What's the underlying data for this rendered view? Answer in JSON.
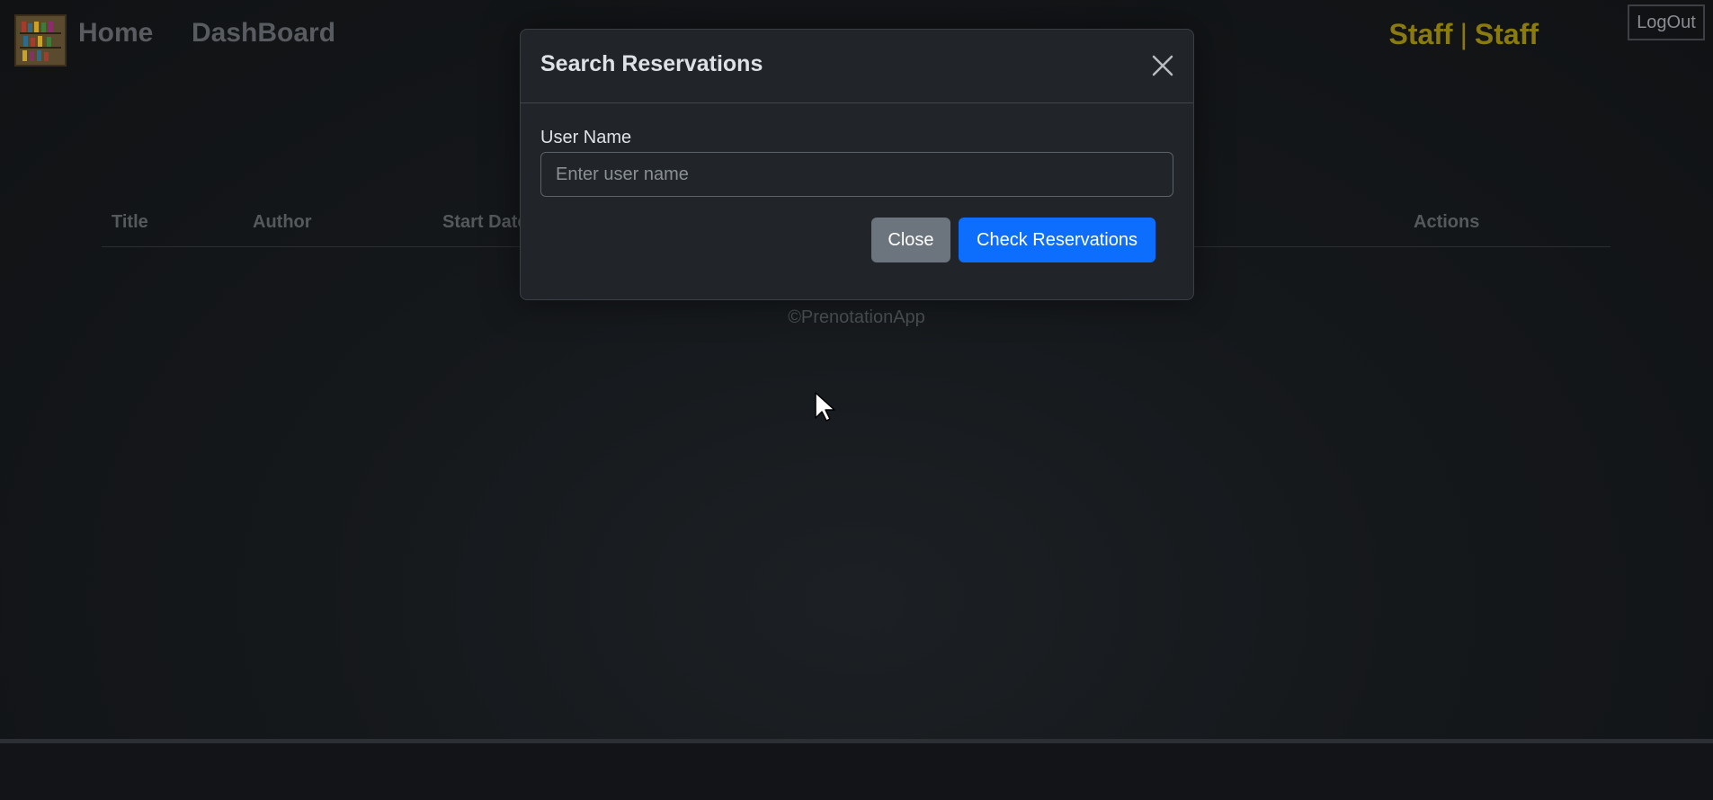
{
  "navbar": {
    "nav_links": [
      "Home",
      "DashBoard"
    ],
    "user_role": "Staff",
    "separator": "|",
    "user_name": "Staff",
    "logout_label": "LogOut"
  },
  "table": {
    "headers": [
      "Title",
      "Author",
      "Start Date",
      "Actions"
    ]
  },
  "footer": {
    "copyright": "©PrenotationApp"
  },
  "modal": {
    "title": "Search Reservations",
    "field_label": "User Name",
    "input_placeholder": "Enter user name",
    "input_value": "",
    "close_label": "Close",
    "submit_label": "Check Reservations"
  },
  "colors": {
    "accent_user": "#8a7a10",
    "primary_button": "#0d6efd",
    "secondary_button": "#6c757d",
    "modal_background": "#212529"
  },
  "icons": [
    "bookshelf-logo-icon",
    "close-icon",
    "mouse-pointer-icon"
  ]
}
